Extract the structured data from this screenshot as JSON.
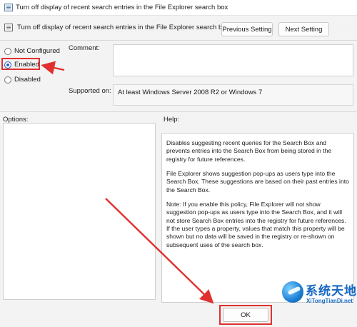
{
  "window": {
    "title": "Turn off display of recent search entries in the File Explorer search box"
  },
  "header": {
    "policy_title": "Turn off display of recent search entries in the File Explorer search box",
    "previous_setting_label": "Previous Setting",
    "next_setting_label": "Next Setting"
  },
  "state": {
    "options": [
      {
        "label": "Not Configured",
        "checked": false
      },
      {
        "label": "Enabled",
        "checked": true
      },
      {
        "label": "Disabled",
        "checked": false
      }
    ]
  },
  "fields": {
    "comment_label": "Comment:",
    "comment_value": "",
    "supported_label": "Supported on:",
    "supported_value": "At least Windows Server 2008 R2 or Windows 7"
  },
  "panes": {
    "options_label": "Options:",
    "help_label": "Help:",
    "help_paragraphs": [
      "Disables suggesting recent queries for the Search Box and prevents entries into the Search Box from being stored in the registry for future references.",
      "File Explorer shows suggestion pop-ups as users type into the Search Box.  These suggestions are based on their past entries into the Search Box.",
      "Note: If you enable this policy, File Explorer will not show suggestion pop-ups as users type into the Search Box, and it will not store Search Box entries into the registry for future references.  If the user types a property, values that match this property will be shown but no data will be saved in the registry or re-shown on subsequent uses of the search box."
    ]
  },
  "footer": {
    "ok_label": "OK"
  },
  "annotations": {
    "highlight_color": "#e0312e"
  },
  "watermark": {
    "name_cn": "系统天地",
    "site": "XiTongTianDi.net"
  },
  "colors": {
    "radio_checked": "#2660c6",
    "watermark": "#1467c2"
  }
}
